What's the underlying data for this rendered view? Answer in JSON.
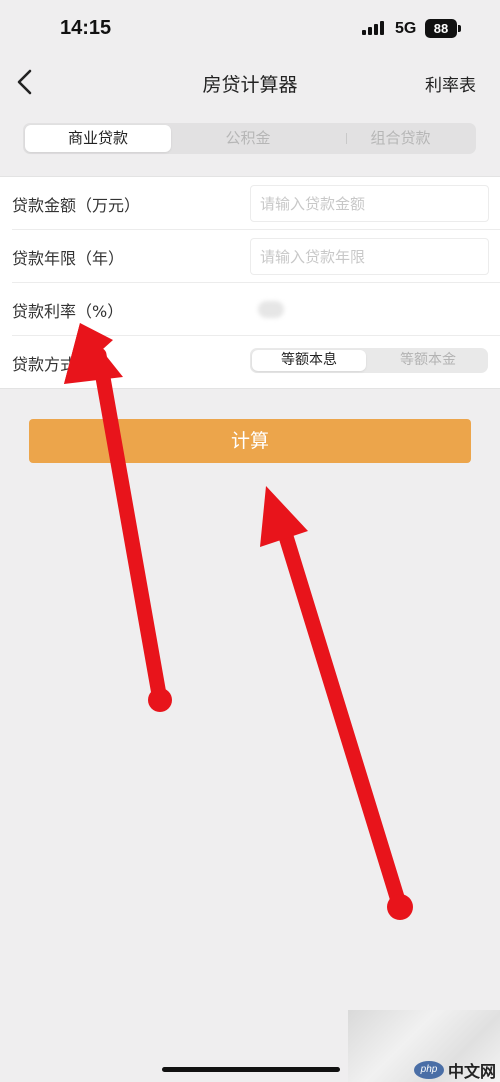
{
  "status_bar": {
    "time": "14:15",
    "network": "5G",
    "battery": "88"
  },
  "nav": {
    "back_icon": "chevron-left-icon",
    "title": "房贷计算器",
    "rate_table": "利率表"
  },
  "loan_tabs": [
    {
      "label": "商业贷款",
      "active": true
    },
    {
      "label": "公积金",
      "active": false
    },
    {
      "label": "组合贷款",
      "active": false
    }
  ],
  "form": {
    "amount": {
      "label": "贷款金额（万元）",
      "value": "",
      "placeholder": "请输入贷款金额"
    },
    "term": {
      "label": "贷款年限（年）",
      "value": "",
      "placeholder": "请输入贷款年限"
    },
    "rate": {
      "label": "贷款利率（%）"
    },
    "method": {
      "label": "贷款方式",
      "options": [
        {
          "label": "等额本息",
          "active": true
        },
        {
          "label": "等额本金",
          "active": false
        }
      ]
    }
  },
  "calculate_label": "计算",
  "watermark": {
    "logo": "php",
    "text": "中文网"
  },
  "colors": {
    "accent": "#eca54b",
    "background": "#efeeef",
    "annotation_arrow": "#e8141b"
  }
}
